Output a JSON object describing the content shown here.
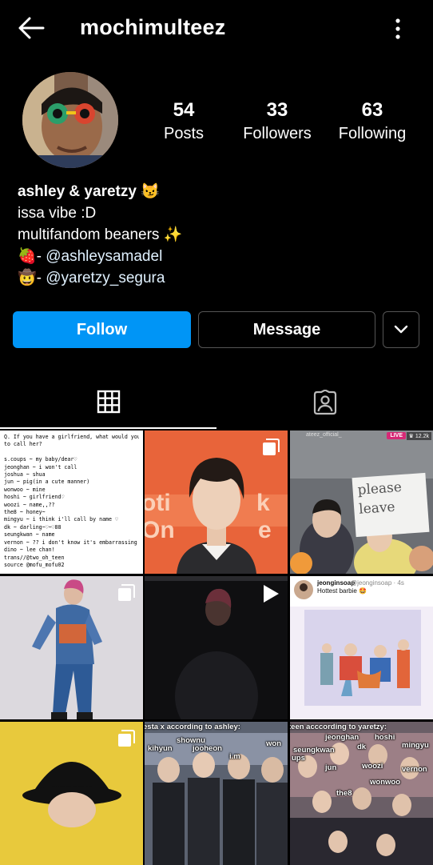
{
  "header": {
    "username": "mochimulteez",
    "back_icon": "arrow-left-icon",
    "more_icon": "vertical-ellipsis-icon"
  },
  "profile": {
    "stats": [
      {
        "value": "54",
        "label": "Posts"
      },
      {
        "value": "33",
        "label": "Followers"
      },
      {
        "value": "63",
        "label": "Following"
      }
    ],
    "bio": {
      "name": "ashley & yaretzy 😼",
      "lines": [
        "issa vibe :D",
        "multifandom beaners ✨"
      ],
      "link1_prefix": "🍓- ",
      "link1": "@ashleysamadel",
      "link2_prefix": "🤠- ",
      "link2": "@yaretzy_segura"
    }
  },
  "actions": {
    "follow": "Follow",
    "message": "Message",
    "dropdown_icon": "chevron-down-icon"
  },
  "tabs": [
    {
      "name": "grid",
      "icon": "grid-icon",
      "active": true
    },
    {
      "name": "tagged",
      "icon": "tagged-person-icon",
      "active": false
    }
  ],
  "posts": {
    "post1_lines": [
      "Q. If you have a girlfriend, what would you want",
      "to call her?",
      "",
      "s.coups ~ my baby/dear♡",
      "jeonghan ~ i won't call",
      "joshua ~ shua",
      "jun ~ pig(in a cute manner)",
      "wonwoo ~ mine",
      "hoshi ~ girlfriend♡",
      "woozi ~ name,,??",
      "the8 ~ honey~",
      "mingyu ~ i think i'll call by name ♡",
      "dk ~ darling~♡~♡88",
      "seungkwan ~ name",
      "vernon ~ ?? i don't know it's embarrassing",
      "dino ~ lee chan!",
      "trans//@two_oh_teen",
      "source @mofu_mofu02"
    ],
    "post3_account": "ateez_official_",
    "post3_live": "LIVE",
    "post3_viewers": "♛ 12.2k",
    "post3_sign": "please leave",
    "post6_name": "jeonginsoap",
    "post6_handle": "@jeonginsoap · 4s",
    "post6_caption": "Hottest barbie 🤩",
    "post8_title": "esta x according to ashley:",
    "post8_labels": [
      "shownu",
      "kihyun",
      "jooheon",
      "i.m",
      "won"
    ],
    "post9_title": "teen acccording to yaretzy:",
    "post9_labels": [
      "jeonghan",
      "hoshi",
      "mingyu",
      "seungkwan",
      "dk",
      "ups",
      "jun",
      "woozi",
      "vernon",
      "wonwoo",
      "the8"
    ]
  },
  "colors": {
    "background": "#000000",
    "follow_button": "#0095f6",
    "outline": "#555555"
  }
}
